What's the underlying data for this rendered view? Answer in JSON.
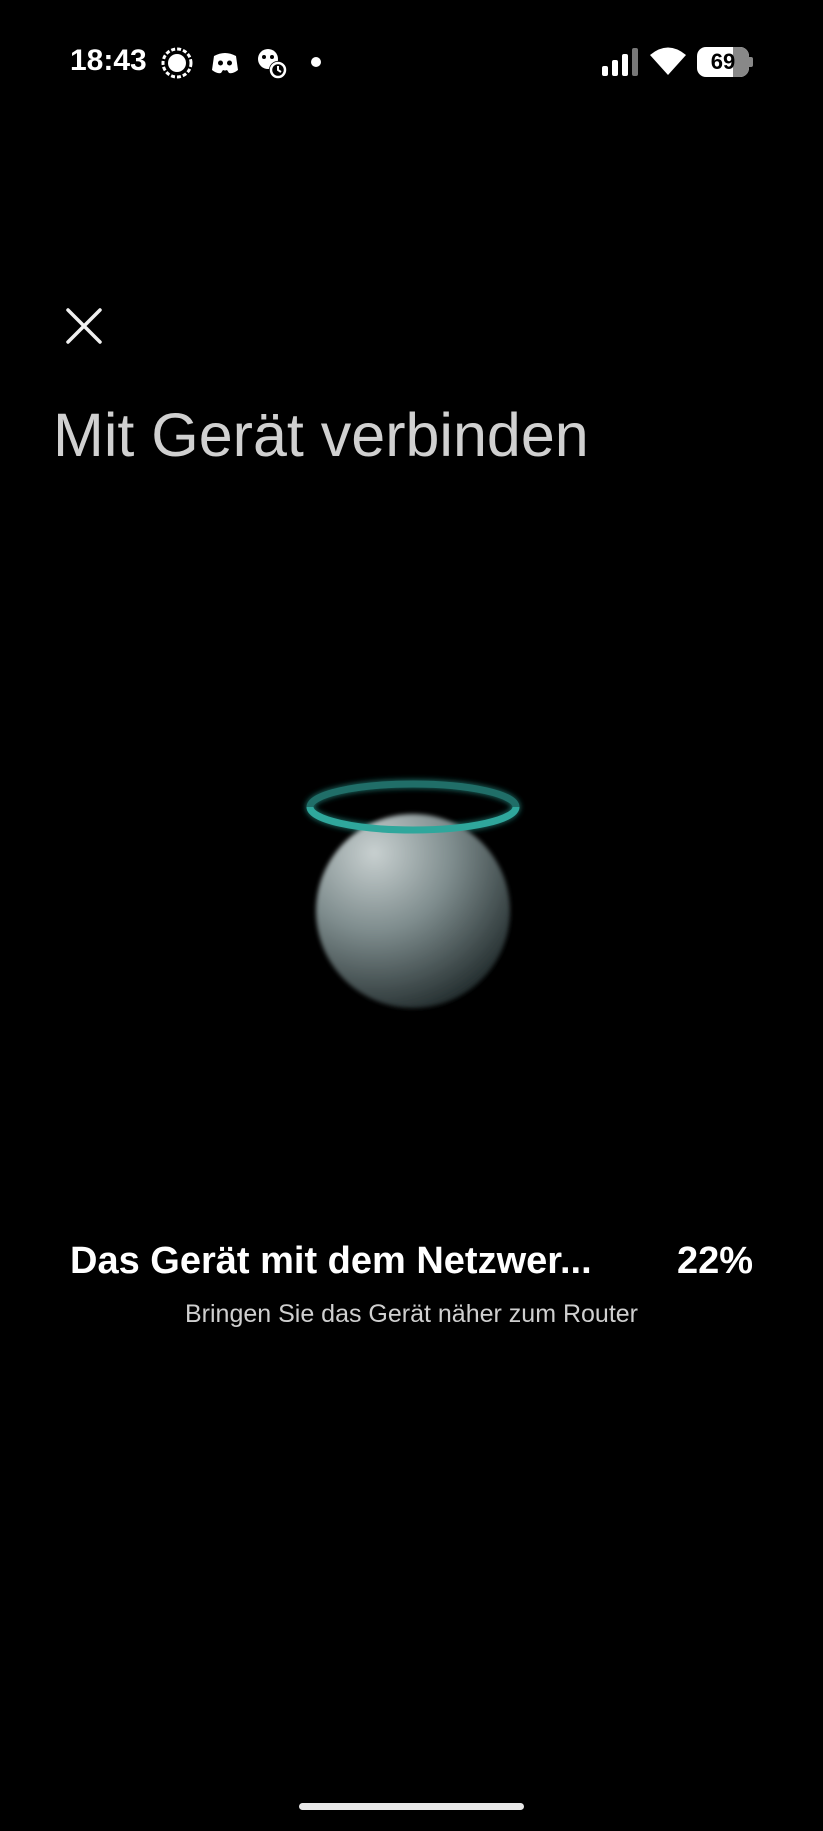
{
  "status_bar": {
    "time": "18:43",
    "notification_icons": [
      "signal-messenger-icon",
      "discord-icon",
      "clock-app-icon"
    ],
    "battery_level": "69",
    "signal_icon": "cellular-signal-icon",
    "wifi_icon": "wifi-icon"
  },
  "header": {
    "close_icon": "close-icon",
    "title": "Mit Gerät verbinden"
  },
  "device": {
    "icon": "smart-device-icon",
    "accent_color": "#2fa79c"
  },
  "progress": {
    "status_text": "Das Gerät mit dem Netzwer...",
    "percent_text": "22%",
    "percent_value": 22,
    "hint": "Bringen Sie das Gerät näher zum Router"
  }
}
